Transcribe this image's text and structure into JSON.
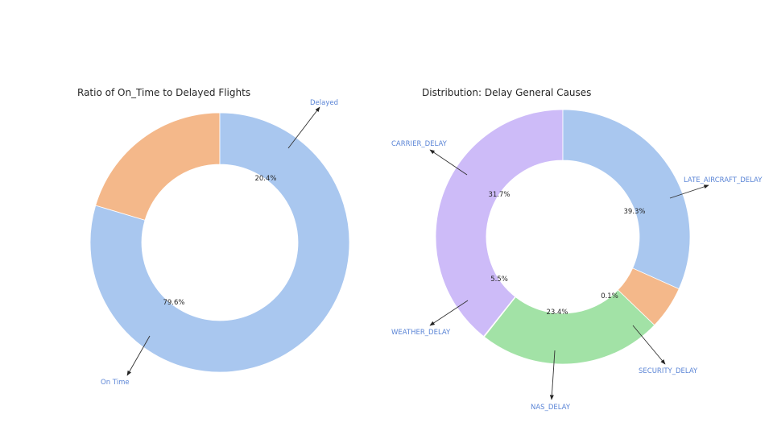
{
  "chart_data": [
    {
      "type": "pie",
      "style": "donut",
      "title": "Ratio of On_Time to Delayed Flights",
      "slices": [
        {
          "label": "Delayed",
          "value": 20.4,
          "display": "20.4%",
          "color": "#f4b88a"
        },
        {
          "label": "On Time",
          "value": 79.6,
          "display": "79.6%",
          "color": "#a9c7ef"
        }
      ]
    },
    {
      "type": "pie",
      "style": "donut",
      "title": "Distribution: Delay General Causes",
      "slices": [
        {
          "label": "LATE_AIRCRAFT_DELAY",
          "value": 39.3,
          "display": "39.3%",
          "color": "#cdbbf8"
        },
        {
          "label": "SECURITY_DELAY",
          "value": 0.1,
          "display": "0.1%",
          "color": "#f8aed3"
        },
        {
          "label": "NAS_DELAY",
          "value": 23.4,
          "display": "23.4%",
          "color": "#a2e2a6"
        },
        {
          "label": "WEATHER_DELAY",
          "value": 5.5,
          "display": "5.5%",
          "color": "#f4b88a"
        },
        {
          "label": "CARRIER_DELAY",
          "value": 31.7,
          "display": "31.7%",
          "color": "#a9c7ef"
        }
      ]
    }
  ]
}
